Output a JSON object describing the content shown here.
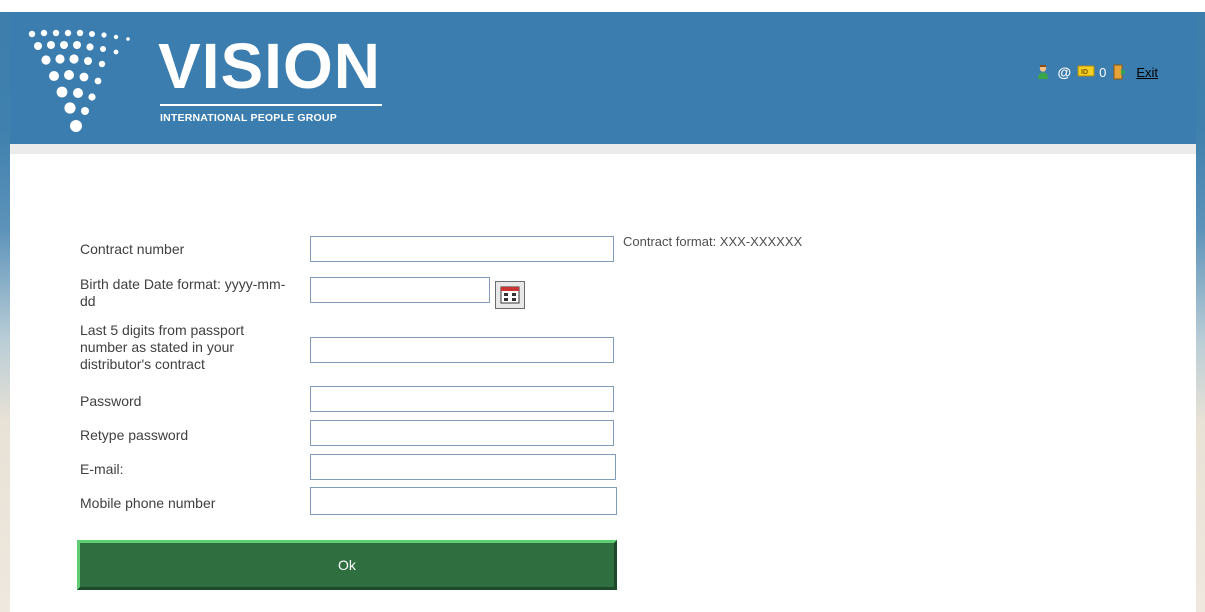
{
  "header": {
    "logo_word": "VISION",
    "logo_sub": "INTERNATIONAL PEOPLE GROUP",
    "tools": {
      "at_symbol": "@",
      "id_count": "0",
      "exit_label": "Exit"
    },
    "icons": [
      "user-icon",
      "email-icon",
      "id-card-icon",
      "exit-door-icon"
    ],
    "colors": {
      "header_bg": "#3a7dae",
      "ok_button": "#2f6e3f",
      "ok_border": "#5dcf72"
    }
  },
  "form": {
    "contract_number": {
      "label": "Contract number",
      "value": "",
      "hint": "Contract format: XXX-XXXXXX"
    },
    "birth_date": {
      "label": "Birth date Date format: yyyy-mm-dd",
      "value": ""
    },
    "passport_digits": {
      "label": "Last 5 digits from passport number as stated in your distributor's contract",
      "value": ""
    },
    "password": {
      "label": "Password",
      "value": ""
    },
    "retype_password": {
      "label": "Retype password",
      "value": ""
    },
    "email": {
      "label": "E-mail:",
      "value": ""
    },
    "mobile_phone": {
      "label": "Mobile phone number",
      "value": ""
    },
    "ok_label": "Ok"
  }
}
